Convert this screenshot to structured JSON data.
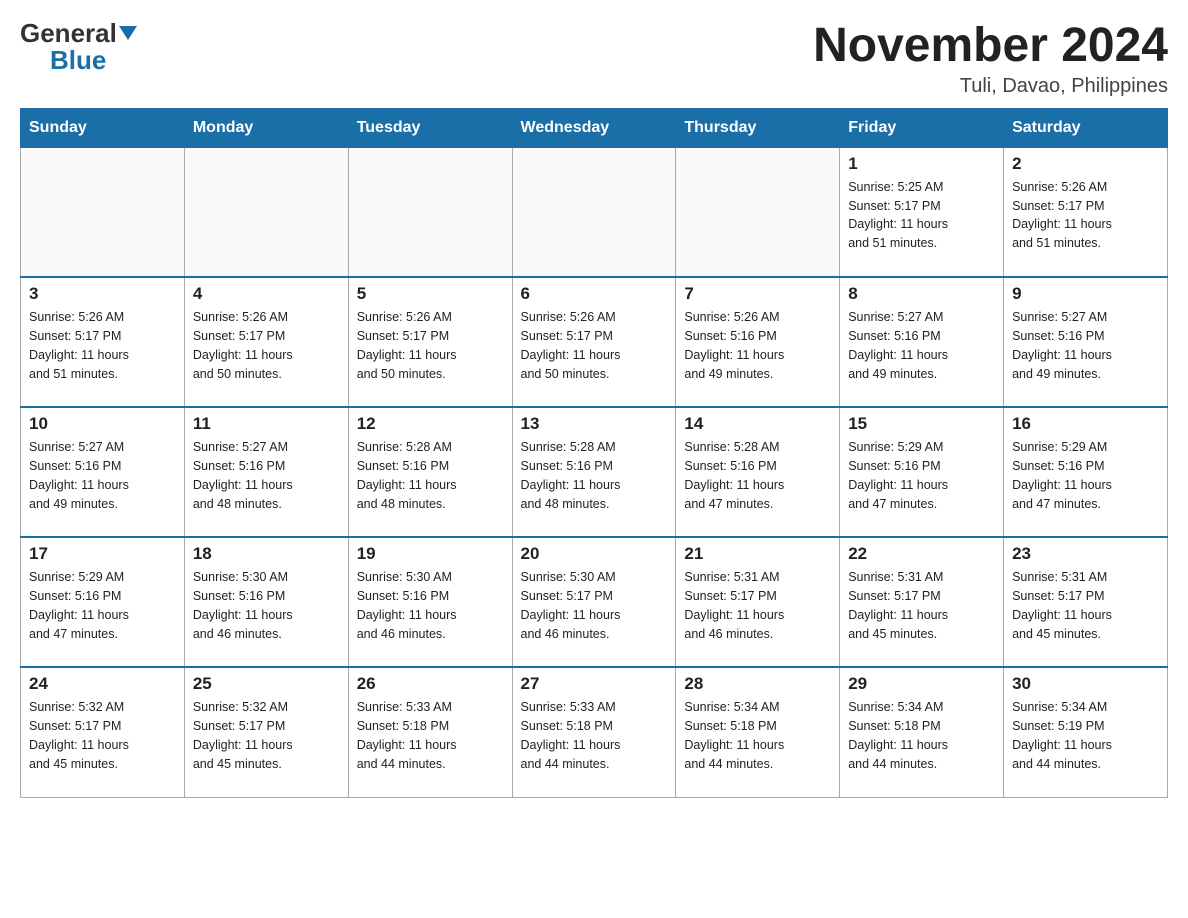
{
  "header": {
    "logo_general": "General",
    "logo_blue": "Blue",
    "month_title": "November 2024",
    "location": "Tuli, Davao, Philippines"
  },
  "days_of_week": [
    "Sunday",
    "Monday",
    "Tuesday",
    "Wednesday",
    "Thursday",
    "Friday",
    "Saturday"
  ],
  "weeks": [
    [
      {
        "day": "",
        "info": ""
      },
      {
        "day": "",
        "info": ""
      },
      {
        "day": "",
        "info": ""
      },
      {
        "day": "",
        "info": ""
      },
      {
        "day": "",
        "info": ""
      },
      {
        "day": "1",
        "info": "Sunrise: 5:25 AM\nSunset: 5:17 PM\nDaylight: 11 hours\nand 51 minutes."
      },
      {
        "day": "2",
        "info": "Sunrise: 5:26 AM\nSunset: 5:17 PM\nDaylight: 11 hours\nand 51 minutes."
      }
    ],
    [
      {
        "day": "3",
        "info": "Sunrise: 5:26 AM\nSunset: 5:17 PM\nDaylight: 11 hours\nand 51 minutes."
      },
      {
        "day": "4",
        "info": "Sunrise: 5:26 AM\nSunset: 5:17 PM\nDaylight: 11 hours\nand 50 minutes."
      },
      {
        "day": "5",
        "info": "Sunrise: 5:26 AM\nSunset: 5:17 PM\nDaylight: 11 hours\nand 50 minutes."
      },
      {
        "day": "6",
        "info": "Sunrise: 5:26 AM\nSunset: 5:17 PM\nDaylight: 11 hours\nand 50 minutes."
      },
      {
        "day": "7",
        "info": "Sunrise: 5:26 AM\nSunset: 5:16 PM\nDaylight: 11 hours\nand 49 minutes."
      },
      {
        "day": "8",
        "info": "Sunrise: 5:27 AM\nSunset: 5:16 PM\nDaylight: 11 hours\nand 49 minutes."
      },
      {
        "day": "9",
        "info": "Sunrise: 5:27 AM\nSunset: 5:16 PM\nDaylight: 11 hours\nand 49 minutes."
      }
    ],
    [
      {
        "day": "10",
        "info": "Sunrise: 5:27 AM\nSunset: 5:16 PM\nDaylight: 11 hours\nand 49 minutes."
      },
      {
        "day": "11",
        "info": "Sunrise: 5:27 AM\nSunset: 5:16 PM\nDaylight: 11 hours\nand 48 minutes."
      },
      {
        "day": "12",
        "info": "Sunrise: 5:28 AM\nSunset: 5:16 PM\nDaylight: 11 hours\nand 48 minutes."
      },
      {
        "day": "13",
        "info": "Sunrise: 5:28 AM\nSunset: 5:16 PM\nDaylight: 11 hours\nand 48 minutes."
      },
      {
        "day": "14",
        "info": "Sunrise: 5:28 AM\nSunset: 5:16 PM\nDaylight: 11 hours\nand 47 minutes."
      },
      {
        "day": "15",
        "info": "Sunrise: 5:29 AM\nSunset: 5:16 PM\nDaylight: 11 hours\nand 47 minutes."
      },
      {
        "day": "16",
        "info": "Sunrise: 5:29 AM\nSunset: 5:16 PM\nDaylight: 11 hours\nand 47 minutes."
      }
    ],
    [
      {
        "day": "17",
        "info": "Sunrise: 5:29 AM\nSunset: 5:16 PM\nDaylight: 11 hours\nand 47 minutes."
      },
      {
        "day": "18",
        "info": "Sunrise: 5:30 AM\nSunset: 5:16 PM\nDaylight: 11 hours\nand 46 minutes."
      },
      {
        "day": "19",
        "info": "Sunrise: 5:30 AM\nSunset: 5:16 PM\nDaylight: 11 hours\nand 46 minutes."
      },
      {
        "day": "20",
        "info": "Sunrise: 5:30 AM\nSunset: 5:17 PM\nDaylight: 11 hours\nand 46 minutes."
      },
      {
        "day": "21",
        "info": "Sunrise: 5:31 AM\nSunset: 5:17 PM\nDaylight: 11 hours\nand 46 minutes."
      },
      {
        "day": "22",
        "info": "Sunrise: 5:31 AM\nSunset: 5:17 PM\nDaylight: 11 hours\nand 45 minutes."
      },
      {
        "day": "23",
        "info": "Sunrise: 5:31 AM\nSunset: 5:17 PM\nDaylight: 11 hours\nand 45 minutes."
      }
    ],
    [
      {
        "day": "24",
        "info": "Sunrise: 5:32 AM\nSunset: 5:17 PM\nDaylight: 11 hours\nand 45 minutes."
      },
      {
        "day": "25",
        "info": "Sunrise: 5:32 AM\nSunset: 5:17 PM\nDaylight: 11 hours\nand 45 minutes."
      },
      {
        "day": "26",
        "info": "Sunrise: 5:33 AM\nSunset: 5:18 PM\nDaylight: 11 hours\nand 44 minutes."
      },
      {
        "day": "27",
        "info": "Sunrise: 5:33 AM\nSunset: 5:18 PM\nDaylight: 11 hours\nand 44 minutes."
      },
      {
        "day": "28",
        "info": "Sunrise: 5:34 AM\nSunset: 5:18 PM\nDaylight: 11 hours\nand 44 minutes."
      },
      {
        "day": "29",
        "info": "Sunrise: 5:34 AM\nSunset: 5:18 PM\nDaylight: 11 hours\nand 44 minutes."
      },
      {
        "day": "30",
        "info": "Sunrise: 5:34 AM\nSunset: 5:19 PM\nDaylight: 11 hours\nand 44 minutes."
      }
    ]
  ]
}
